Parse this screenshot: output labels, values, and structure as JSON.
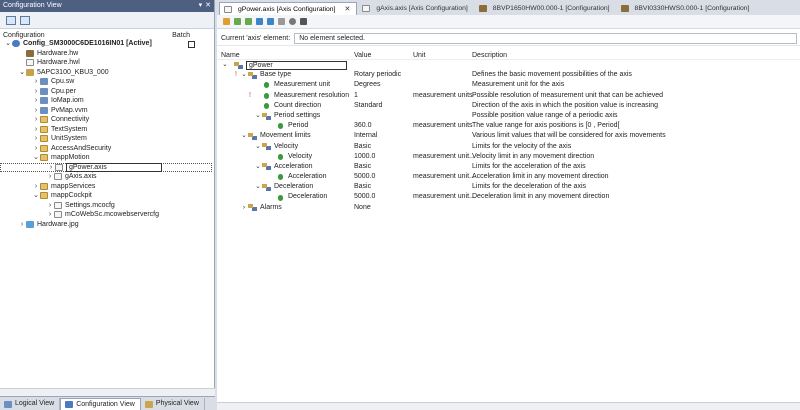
{
  "left_pane": {
    "title": "Configuration View",
    "col_configuration": "Configuration",
    "col_batch": "Batch",
    "tree": [
      {
        "label": "Config_SM3000C6DE1016IN01 [Active]",
        "level": 0,
        "arrow": "v",
        "icon": "cfg",
        "bold": true
      },
      {
        "label": "Hardware.hw",
        "level": 1,
        "arrow": "",
        "icon": "hw"
      },
      {
        "label": "Hardware.hwl",
        "level": 1,
        "arrow": "",
        "icon": "file"
      },
      {
        "label": "5APC3100_KBU3_000",
        "level": 1,
        "arrow": "v",
        "icon": "plc"
      },
      {
        "label": "Cpu.sw",
        "level": 2,
        "arrow": ">",
        "icon": "cpu"
      },
      {
        "label": "Cpu.per",
        "level": 2,
        "arrow": ">",
        "icon": "cpu"
      },
      {
        "label": "IoMap.iom",
        "level": 2,
        "arrow": ">",
        "icon": "cpu"
      },
      {
        "label": "PvMap.vvm",
        "level": 2,
        "arrow": ">",
        "icon": "cpu"
      },
      {
        "label": "Connectivity",
        "level": 2,
        "arrow": ">",
        "icon": "folder"
      },
      {
        "label": "TextSystem",
        "level": 2,
        "arrow": ">",
        "icon": "folder"
      },
      {
        "label": "UnitSystem",
        "level": 2,
        "arrow": ">",
        "icon": "folder"
      },
      {
        "label": "AccessAndSecurity",
        "level": 2,
        "arrow": ">",
        "icon": "folder"
      },
      {
        "label": "mappMotion",
        "level": 2,
        "arrow": "v",
        "icon": "folder"
      },
      {
        "label": "gPower.axis",
        "level": 3,
        "arrow": ">",
        "icon": "file",
        "selected": true
      },
      {
        "label": "gAxis.axis",
        "level": 3,
        "arrow": ">",
        "icon": "file"
      },
      {
        "label": "mappServices",
        "level": 2,
        "arrow": ">",
        "icon": "folder"
      },
      {
        "label": "mappCockpit",
        "level": 2,
        "arrow": "v",
        "icon": "folder"
      },
      {
        "label": "Settings.mcocfg",
        "level": 3,
        "arrow": ">",
        "icon": "file"
      },
      {
        "label": "mCoWebSc.mcowebservercfg",
        "level": 3,
        "arrow": ">",
        "icon": "file"
      },
      {
        "label": "Hardware.jpg",
        "level": 1,
        "arrow": ">",
        "icon": "img"
      }
    ],
    "bottom_tabs": [
      "Logical View",
      "Configuration View",
      "Physical View"
    ]
  },
  "editor": {
    "tabs": [
      {
        "label": "gPower.axis [Axis Configuration]",
        "active": true
      },
      {
        "label": "gAxis.axis [Axis Configuration]",
        "active": false
      },
      {
        "label": "8BVP1650HW00.000-1 [Configuration]",
        "active": false
      },
      {
        "label": "8BVI0330HWS0.000-1 [Configuration]",
        "active": false
      }
    ],
    "current_label": "Current 'axis' element:",
    "current_value": "No element selected.",
    "columns": {
      "name": "Name",
      "value": "Value",
      "unit": "Unit",
      "description": "Description"
    },
    "rows": [
      {
        "name": "gPower",
        "value": "",
        "unit": "",
        "desc": "",
        "level": 0,
        "arrow": "v",
        "icon": "group",
        "edit": true
      },
      {
        "name": "Base type",
        "value": "Rotary periodic",
        "unit": "",
        "desc": "Defines the basic movement possibilities of the axis",
        "level": 1,
        "arrow": "v",
        "icon": "group",
        "warn": true
      },
      {
        "name": "Measurement unit",
        "value": "Degrees",
        "unit": "",
        "desc": "Measurement unit for the axis",
        "level": 2,
        "arrow": "",
        "icon": "param"
      },
      {
        "name": "Measurement resolution",
        "value": "1",
        "unit": "measurement units",
        "desc": "Possible resolution of measurement unit that can be achieved",
        "level": 2,
        "arrow": "",
        "icon": "param",
        "warn": true
      },
      {
        "name": "Count direction",
        "value": "Standard",
        "unit": "",
        "desc": "Direction of the axis in which the position value is increasing",
        "level": 2,
        "arrow": "",
        "icon": "param"
      },
      {
        "name": "Period settings",
        "value": "",
        "unit": "",
        "desc": "Possible position value range of a periodic axis",
        "level": 2,
        "arrow": "v",
        "icon": "group"
      },
      {
        "name": "Period",
        "value": "360.0",
        "unit": "measurement units",
        "desc": "The value range for axis positions is [0 , Period[",
        "level": 3,
        "arrow": "",
        "icon": "param"
      },
      {
        "name": "Movement limits",
        "value": "Internal",
        "unit": "",
        "desc": "Various limit values that will be considered for axis movements",
        "level": 1,
        "arrow": "v",
        "icon": "group"
      },
      {
        "name": "Velocity",
        "value": "Basic",
        "unit": "",
        "desc": "Limits for the velocity of the axis",
        "level": 2,
        "arrow": "v",
        "icon": "group"
      },
      {
        "name": "Velocity",
        "value": "1000.0",
        "unit": "measurement unit...",
        "desc": "Velocity limit in any movement direction",
        "level": 3,
        "arrow": "",
        "icon": "param"
      },
      {
        "name": "Acceleration",
        "value": "Basic",
        "unit": "",
        "desc": "Limits for the acceleration of the axis",
        "level": 2,
        "arrow": "v",
        "icon": "group"
      },
      {
        "name": "Acceleration",
        "value": "5000.0",
        "unit": "measurement unit...",
        "desc": "Acceleration limit in any movement direction",
        "level": 3,
        "arrow": "",
        "icon": "param"
      },
      {
        "name": "Deceleration",
        "value": "Basic",
        "unit": "",
        "desc": "Limits for the deceleration of the axis",
        "level": 2,
        "arrow": "v",
        "icon": "group"
      },
      {
        "name": "Deceleration",
        "value": "5000.0",
        "unit": "measurement unit...",
        "desc": "Deceleration limit in any movement direction",
        "level": 3,
        "arrow": "",
        "icon": "param"
      },
      {
        "name": "Alarms",
        "value": "None",
        "unit": "",
        "desc": "",
        "level": 1,
        "arrow": ">",
        "icon": "group"
      }
    ]
  },
  "colors": {
    "title_bar": "#4d6082",
    "frame": "#d8dde6",
    "param_icon": "#3b9a3b",
    "warning": "#d03a2a"
  }
}
